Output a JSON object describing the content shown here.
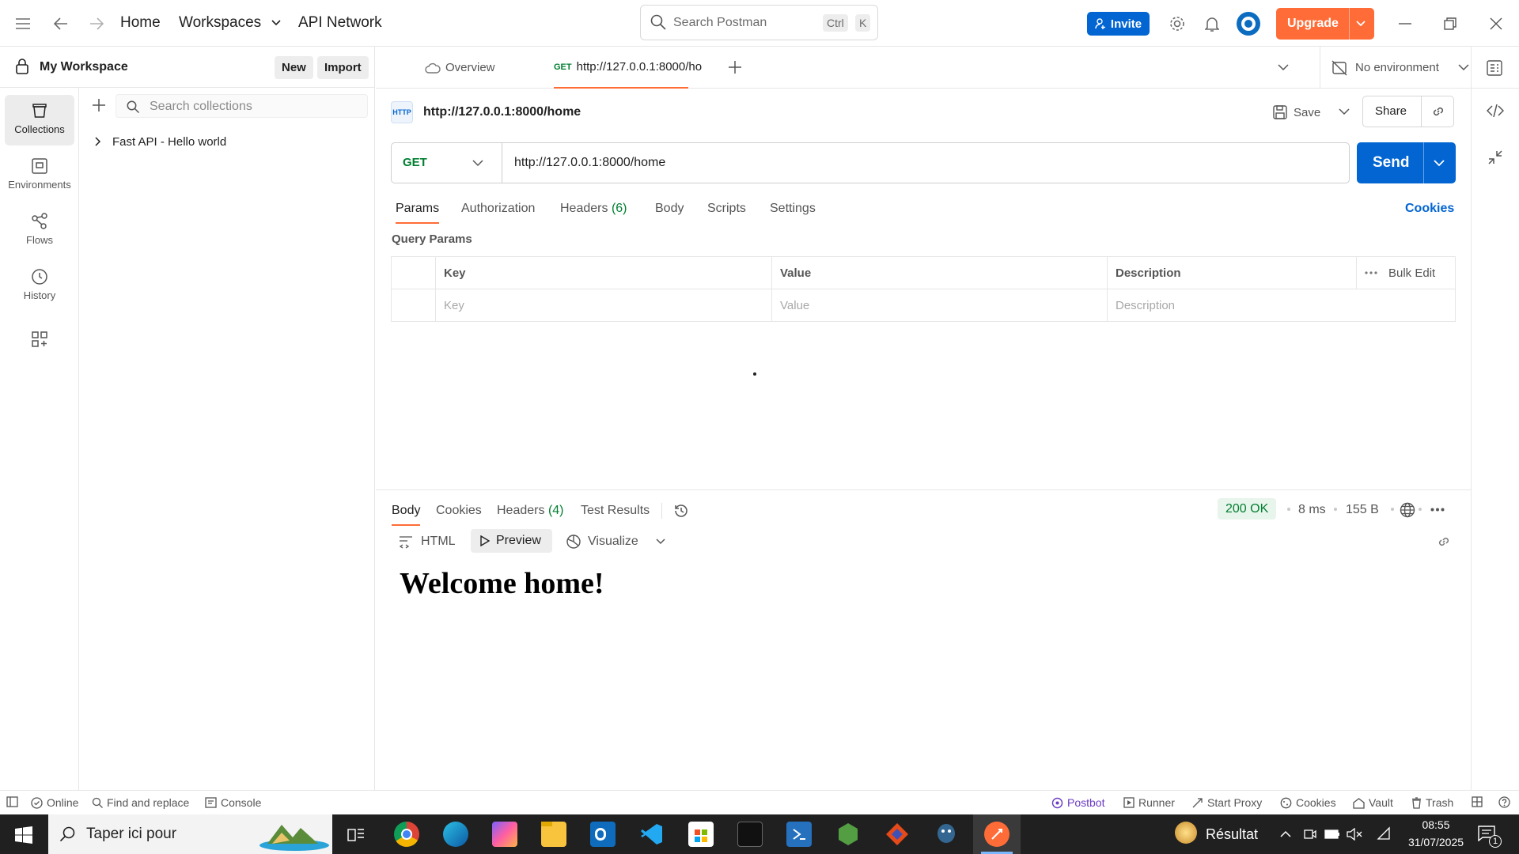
{
  "topbar": {
    "home": "Home",
    "workspaces": "Workspaces",
    "api_network": "API Network",
    "search_placeholder": "Search Postman",
    "kbd1": "Ctrl",
    "kbd2": "K",
    "invite": "Invite",
    "upgrade": "Upgrade"
  },
  "sidebar": {
    "workspace": "My Workspace",
    "new": "New",
    "import": "Import",
    "search_placeholder": "Search collections",
    "rail": [
      {
        "label": "Collections"
      },
      {
        "label": "Environments"
      },
      {
        "label": "Flows"
      },
      {
        "label": "History"
      }
    ],
    "collections": [
      "Fast API - Hello world"
    ]
  },
  "tabs": {
    "overview": "Overview",
    "request_method": "GET",
    "request_title": "http://127.0.0.1:8000/ho",
    "environment": "No environment"
  },
  "request": {
    "name": "http://127.0.0.1:8000/home",
    "http_badge": "HTTP",
    "save": "Save",
    "share": "Share",
    "method": "GET",
    "url": "http://127.0.0.1:8000/home",
    "send": "Send",
    "tabs": {
      "params": "Params",
      "authorization": "Authorization",
      "headers": "Headers",
      "headers_count": "(6)",
      "body": "Body",
      "scripts": "Scripts",
      "settings": "Settings"
    },
    "cookies": "Cookies",
    "query_params_title": "Query Params",
    "table": {
      "key": "Key",
      "value": "Value",
      "description": "Description",
      "bulk_edit": "Bulk Edit",
      "key_ph": "Key",
      "value_ph": "Value",
      "description_ph": "Description"
    }
  },
  "response": {
    "tabs": {
      "body": "Body",
      "cookies": "Cookies",
      "headers": "Headers",
      "headers_count": "(4)",
      "test_results": "Test Results"
    },
    "status": "200 OK",
    "time": "8 ms",
    "size": "155 B",
    "html": "HTML",
    "preview": "Preview",
    "visualize": "Visualize",
    "content": "Welcome home!"
  },
  "statusbar": {
    "online": "Online",
    "find_replace": "Find and replace",
    "console": "Console",
    "postbot": "Postbot",
    "runner": "Runner",
    "start_proxy": "Start Proxy",
    "cookies": "Cookies",
    "vault": "Vault",
    "trash": "Trash"
  },
  "taskbar": {
    "search_placeholder": "Taper ici pour",
    "weather": "Résultat",
    "time": "08:55",
    "date": "31/07/2025",
    "notifications": "1"
  },
  "colors": {
    "accent": "#ff6c37",
    "primary": "#0265d2",
    "status_ok": "#007f31",
    "taskbar": "#202020"
  }
}
